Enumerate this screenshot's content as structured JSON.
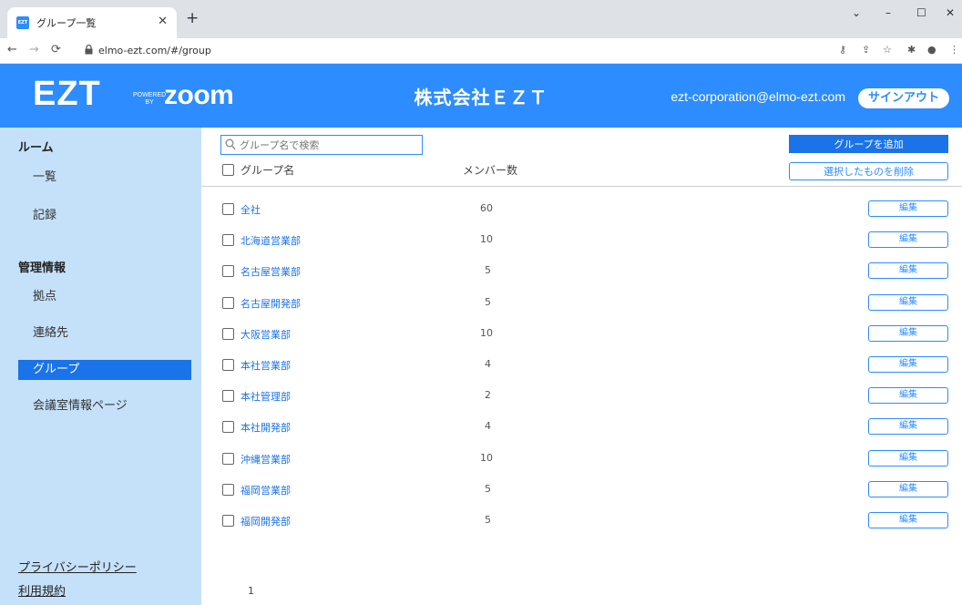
{
  "browser": {
    "tab_title": "グループ一覧",
    "tab_favicon": "EZT",
    "url": "elmo-ezt.com/#/group"
  },
  "header": {
    "logo_main": "EZT",
    "logo_powered": "POWERED",
    "logo_by": "BY",
    "logo_zoom": "zoom",
    "company": "株式会社ＥＺＴ",
    "email": "ezt-corporation@elmo-ezt.com",
    "signout_label": "サインアウト",
    "brand_color": "#2d8cff"
  },
  "sidebar": {
    "section_room": "ルーム",
    "room_items": [
      {
        "label": "一覧"
      },
      {
        "label": "記録"
      }
    ],
    "section_manage": "管理情報",
    "manage_items": [
      {
        "label": "拠点"
      },
      {
        "label": "連絡先"
      },
      {
        "label": "グループ"
      },
      {
        "label": "会議室情報ページ"
      }
    ],
    "active_item": "グループ",
    "footer_links": [
      {
        "label": "プライバシーポリシー"
      },
      {
        "label": "利用規約"
      }
    ]
  },
  "main": {
    "search_placeholder": "グループ名で検索",
    "add_button": "グループを追加",
    "delete_button": "選択したものを削除",
    "col_name": "グループ名",
    "col_members": "メンバー数",
    "edit_label": "編集",
    "rows": [
      {
        "name": "全社",
        "count": "60"
      },
      {
        "name": "北海道営業部",
        "count": "10"
      },
      {
        "name": "名古屋営業部",
        "count": "5"
      },
      {
        "name": "名古屋開発部",
        "count": "5"
      },
      {
        "name": "大阪営業部",
        "count": "10"
      },
      {
        "name": "本社営業部",
        "count": "4"
      },
      {
        "name": "本社管理部",
        "count": "2"
      },
      {
        "name": "本社開発部",
        "count": "4"
      },
      {
        "name": "沖縄営業部",
        "count": "10"
      },
      {
        "name": "福岡営業部",
        "count": "5"
      },
      {
        "name": "福岡開発部",
        "count": "5"
      }
    ],
    "page": "1"
  }
}
